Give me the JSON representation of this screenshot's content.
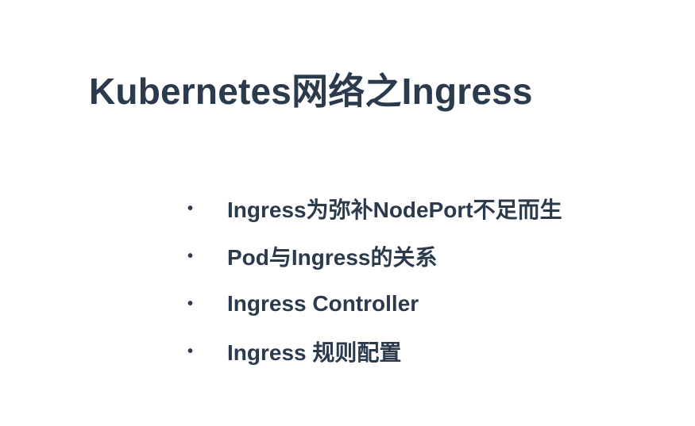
{
  "slide": {
    "title": "Kubernetes网络之Ingress",
    "bullet_glyph": "•",
    "bullets": [
      "Ingress为弥补NodePort不足而生",
      "Pod与Ingress的关系",
      "Ingress Controller",
      "Ingress 规则配置"
    ]
  },
  "colors": {
    "text": "#2b3a4c",
    "background": "#ffffff"
  }
}
